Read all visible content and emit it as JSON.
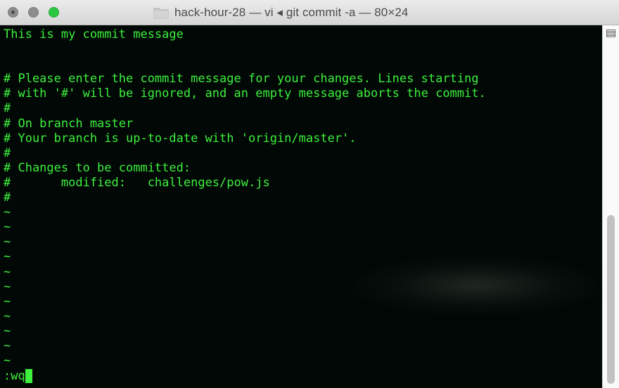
{
  "window": {
    "title": "hack-hour-28 — vi ◂ git commit -a — 80×24"
  },
  "editor": {
    "lines": [
      "This is my commit message",
      "",
      "",
      "# Please enter the commit message for your changes. Lines starting",
      "# with '#' will be ignored, and an empty message aborts the commit.",
      "#",
      "# On branch master",
      "# Your branch is up-to-date with 'origin/master'.",
      "#",
      "# Changes to be committed:",
      "#       modified:   challenges/pow.js",
      "#",
      "~",
      "~",
      "~",
      "~",
      "~",
      "~",
      "~",
      "~",
      "~",
      "~",
      "~"
    ],
    "command": ":wq"
  },
  "colors": {
    "text": "#3df03d",
    "background": "#020806",
    "maximize_button": "#2bc840"
  },
  "icons": {
    "close": "close-button-icon",
    "minimize": "minimize-button-icon",
    "maximize": "maximize-button-icon",
    "folder": "folder-icon",
    "scroll_marker": "scroll-marker-icon"
  }
}
